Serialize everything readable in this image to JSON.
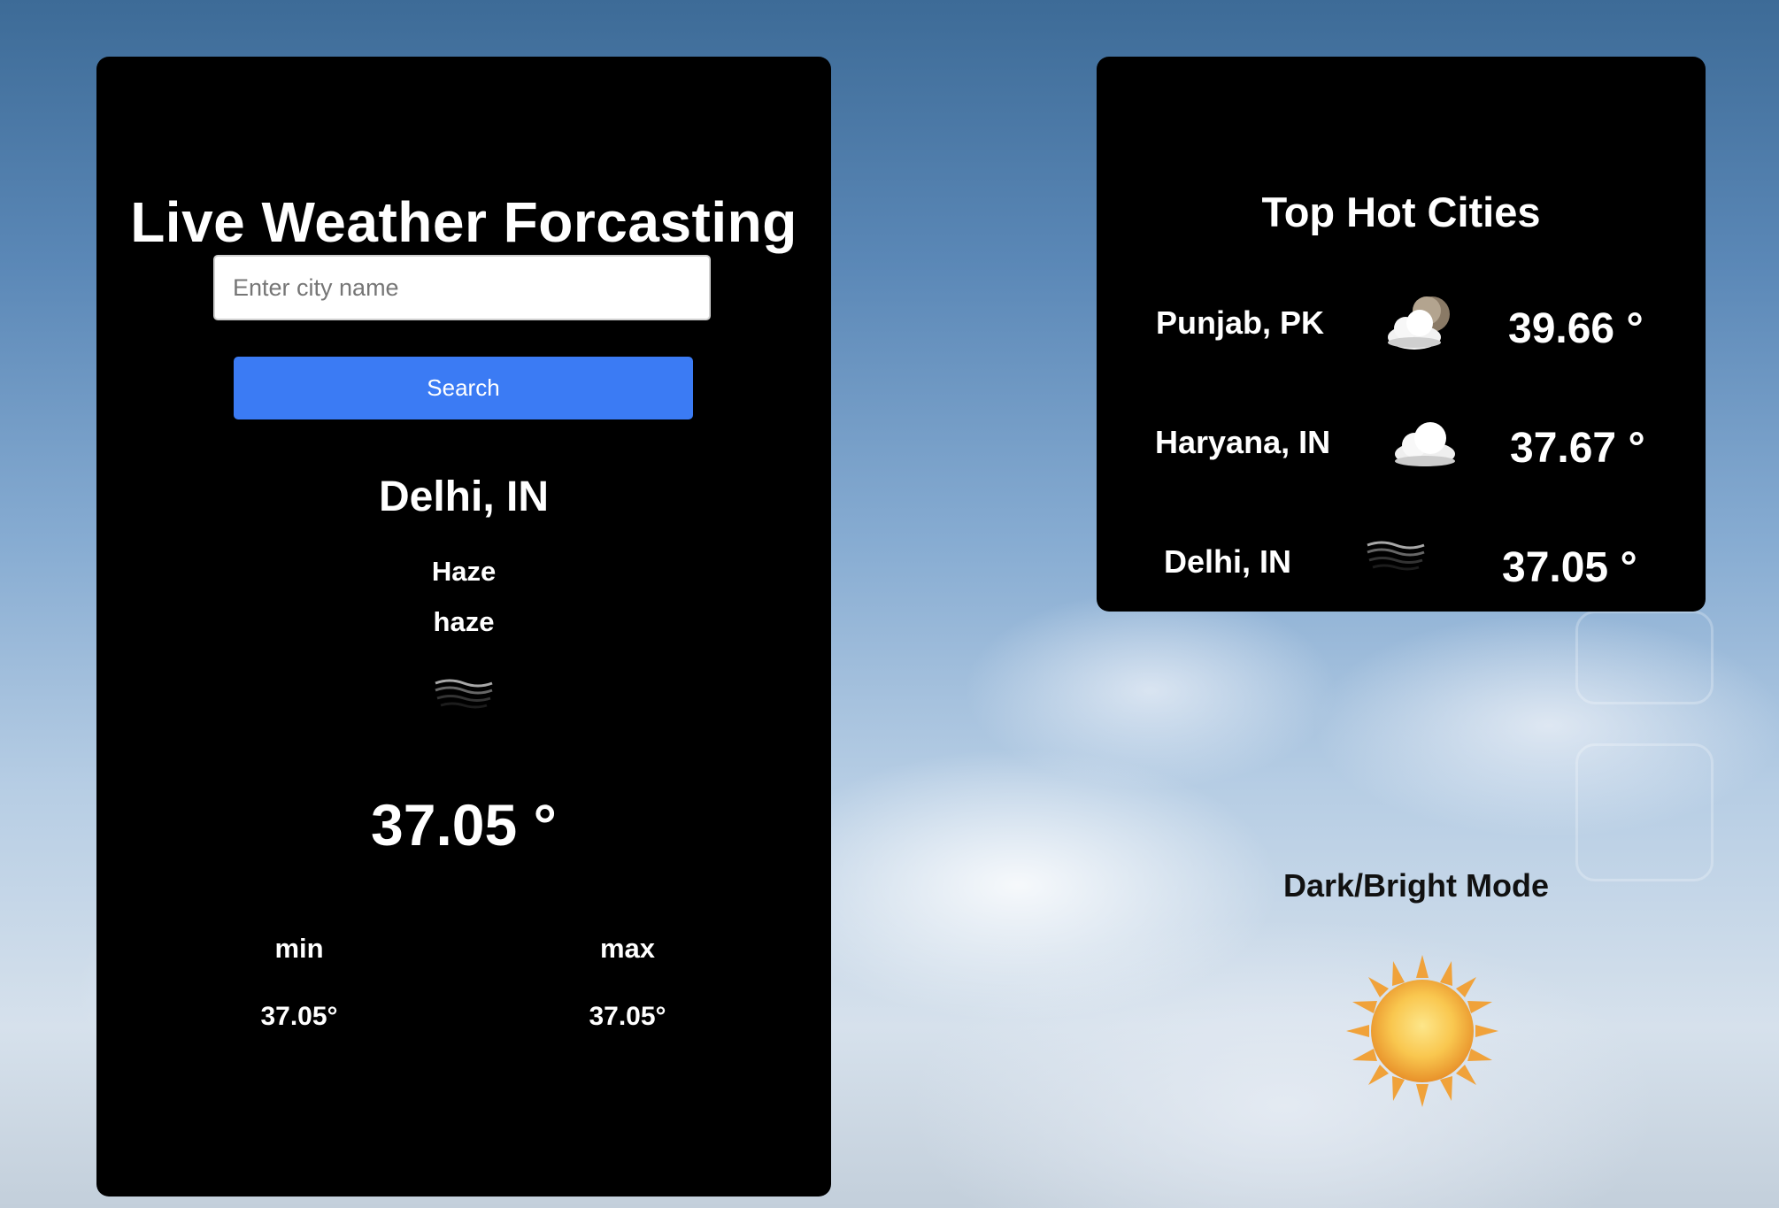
{
  "main": {
    "title": "Live Weather Forcasting",
    "search": {
      "placeholder": "Enter city name",
      "value": ""
    },
    "search_button_label": "Search",
    "city": "Delhi, IN",
    "condition": "Haze",
    "description": "haze",
    "icon": "haze-icon",
    "temperature": "37.05 °",
    "min_label": "min",
    "max_label": "max",
    "min_value": "37.05°",
    "max_value": "37.05°"
  },
  "hot_cities": {
    "title": "Top Hot Cities",
    "items": [
      {
        "city": "Punjab, PK",
        "icon": "partly-cloudy-night-icon",
        "temp": "39.66 °"
      },
      {
        "city": "Haryana, IN",
        "icon": "cloud-icon",
        "temp": "37.67 °"
      },
      {
        "city": "Delhi, IN",
        "icon": "haze-icon",
        "temp": "37.05 °"
      }
    ]
  },
  "mode_toggle": {
    "label": "Dark/Bright Mode",
    "icon": "sun-icon"
  },
  "colors": {
    "card_bg": "#000000",
    "accent": "#3b7bf4",
    "text": "#ffffff"
  }
}
